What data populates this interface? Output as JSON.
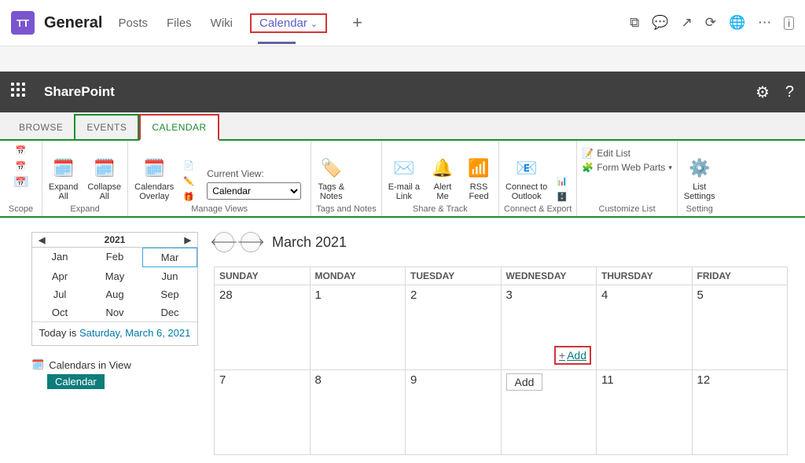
{
  "teams_header": {
    "badge": "TT",
    "channel": "General",
    "tabs": [
      "Posts",
      "Files",
      "Wiki"
    ],
    "selected_tab": "Calendar"
  },
  "sp_bar": {
    "title": "SharePoint"
  },
  "ribbon_tabs": {
    "browse": "BROWSE",
    "events": "EVENTS",
    "calendar": "CALENDAR"
  },
  "ribbon": {
    "scope_label": "Scope",
    "expand": {
      "expand_all": "Expand\nAll",
      "collapse_all": "Collapse\nAll",
      "group": "Expand"
    },
    "manage": {
      "overlay": "Calendars\nOverlay",
      "current_view_label": "Current View:",
      "current_view": "Calendar",
      "group": "Manage Views"
    },
    "tags": {
      "item": "Tags &\nNotes",
      "group": "Tags and Notes"
    },
    "share": {
      "email": "E-mail a\nLink",
      "alert": "Alert\nMe",
      "rss": "RSS\nFeed",
      "group": "Share & Track"
    },
    "connect": {
      "outlook": "Connect to\nOutlook",
      "group": "Connect & Export"
    },
    "customize": {
      "edit": "Edit List",
      "form": "Form Web Parts",
      "group": "Customize List"
    },
    "settings": {
      "item": "List\nSettings",
      "group": "Setting"
    }
  },
  "picker": {
    "year": "2021",
    "months": [
      "Jan",
      "Feb",
      "Mar",
      "Apr",
      "May",
      "Jun",
      "Jul",
      "Aug",
      "Sep",
      "Oct",
      "Nov",
      "Dec"
    ],
    "active_index": 2,
    "today_prefix": "Today is ",
    "today_link": "Saturday, March 6, 2021"
  },
  "calendars_in_view": {
    "label": "Calendars in View",
    "item": "Calendar"
  },
  "calendar": {
    "title": "March 2021",
    "day_headers": [
      "SUNDAY",
      "MONDAY",
      "TUESDAY",
      "WEDNESDAY",
      "THURSDAY",
      "FRIDAY"
    ],
    "weeks": [
      {
        "days": [
          "28",
          "1",
          "2",
          "3",
          "4",
          "5"
        ],
        "add_in": 3,
        "add_label": "Add"
      },
      {
        "days": [
          "7",
          "8",
          "9",
          "",
          "11",
          "12"
        ],
        "plain_add_in": 3,
        "add_label": "Add"
      }
    ]
  }
}
